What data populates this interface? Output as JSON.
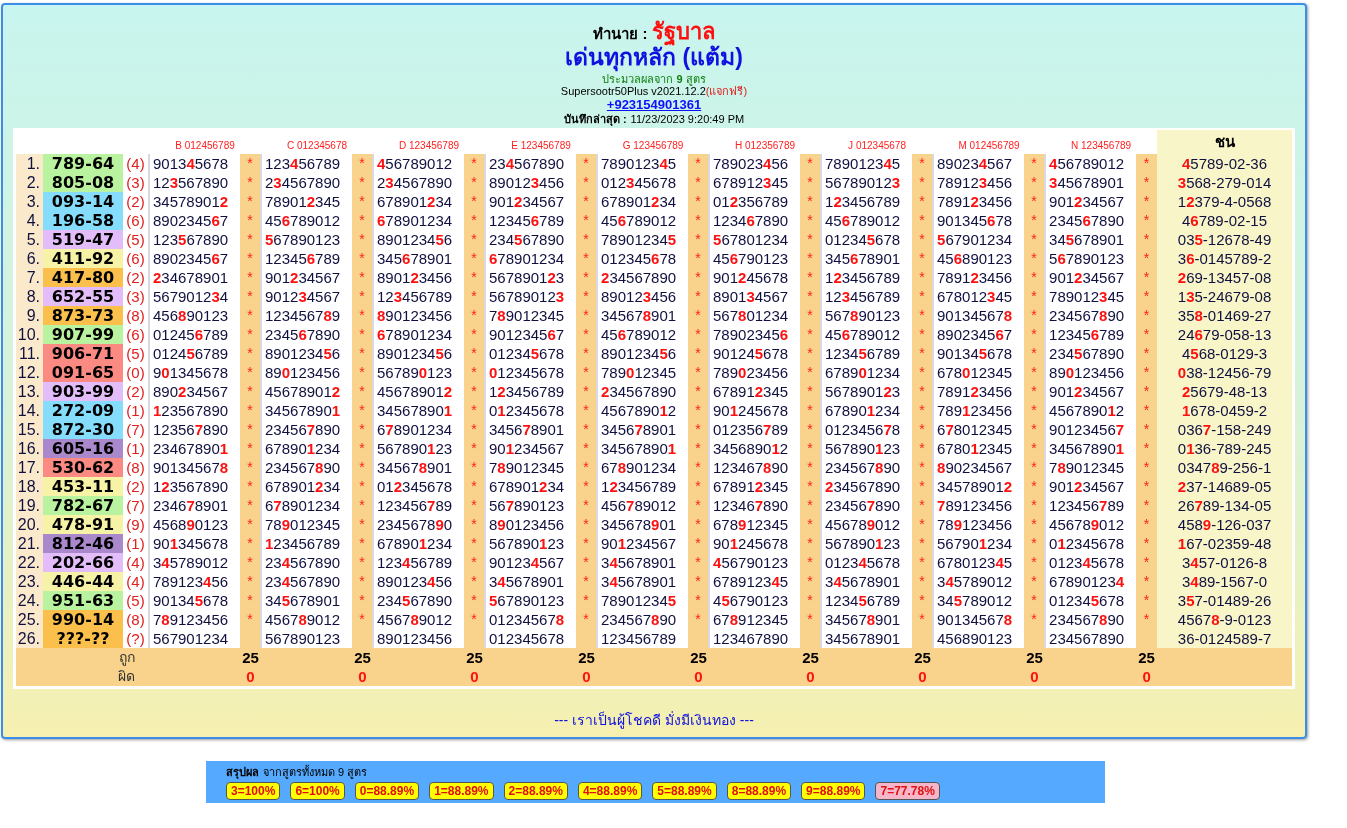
{
  "header": {
    "prefix": "ทำนาย :",
    "title": "รัฐบาล",
    "subtitle": "เด่นทุกหลัก (แต้ม)",
    "formula_note": "ประมวลผลจาก **9** สูตร",
    "version": "Supersootr50Plus v2021.12.2",
    "version_note": "(แจกฟรี)",
    "phone": "+923154901361",
    "saved_label": "บันทึกล่าสุด :",
    "saved_time": "11/23/2023 9:20:49 PM"
  },
  "table": {
    "columns": [
      "B 012456789",
      "C 012345678",
      "D 123456789",
      "E 123456789",
      "G 123456789",
      "H 012356789",
      "J 012345678",
      "M 012456789",
      "N 123456789"
    ],
    "last_column": "ชน",
    "rows": [
      {
        "index": "1.",
        "result": "789-64",
        "color": "#b9f3a0",
        "digit": "(4)",
        "cells": [
          [
            "9013**4**5678",
            "*"
          ],
          [
            "123**4**56789",
            "*"
          ],
          [
            "**4**56789012",
            "*"
          ],
          [
            "23**4**567890",
            "*"
          ],
          [
            "7890123**4**5",
            "*"
          ],
          [
            "789023**4**56",
            "*"
          ],
          [
            "7890123**4**5",
            "*"
          ],
          [
            "89023**4**567",
            "*"
          ],
          [
            "**4**56789012",
            "*"
          ]
        ],
        "chon": "**4**5789-02-36"
      },
      {
        "index": "2.",
        "result": "805-08",
        "color": "#b9f3a0",
        "digit": "(3)",
        "cells": [
          [
            "12**3**567890",
            "*"
          ],
          [
            "2**3**4567890",
            "*"
          ],
          [
            "2**3**4567890",
            "*"
          ],
          [
            "89012**3**456",
            "*"
          ],
          [
            "012**3**45678",
            "*"
          ],
          [
            "678912**3**45",
            "*"
          ],
          [
            "56789012**3**",
            "*"
          ],
          [
            "78912**3**456",
            "*"
          ],
          [
            "**3**45678901",
            "*"
          ]
        ],
        "chon": "**3**568-279-014"
      },
      {
        "index": "3.",
        "result": "093-14",
        "color": "#86dcfb",
        "digit": "(2)",
        "cells": [
          [
            "34578901**2**",
            "*"
          ],
          [
            "78901**2**345",
            "*"
          ],
          [
            "678901**2**34",
            "*"
          ],
          [
            "901**2**34567",
            "*"
          ],
          [
            "678901**2**34",
            "*"
          ],
          [
            "01**2**356789",
            "*"
          ],
          [
            "1**2**3456789",
            "*"
          ],
          [
            "7891**2**3456",
            "*"
          ],
          [
            "901**2**34567",
            "*"
          ]
        ],
        "chon": "1**2**379-4-0568"
      },
      {
        "index": "4.",
        "result": "196-58",
        "color": "#86dcfb",
        "digit": "(6)",
        "cells": [
          [
            "8902345**6**7",
            "*"
          ],
          [
            "45**6**789012",
            "*"
          ],
          [
            "**6**78901234",
            "*"
          ],
          [
            "12345**6**789",
            "*"
          ],
          [
            "45**6**789012",
            "*"
          ],
          [
            "1234**6**7890",
            "*"
          ],
          [
            "45**6**789012",
            "*"
          ],
          [
            "901345**6**78",
            "*"
          ],
          [
            "2345**6**7890",
            "*"
          ]
        ],
        "chon": "4**6**789-02-15"
      },
      {
        "index": "5.",
        "result": "519-47",
        "color": "#e3bdf9",
        "digit": "(5)",
        "cells": [
          [
            "123**5**67890",
            "*"
          ],
          [
            "**5**67890123",
            "*"
          ],
          [
            "8901234**5**6",
            "*"
          ],
          [
            "234**5**67890",
            "*"
          ],
          [
            "78901234**5**",
            "*"
          ],
          [
            "**5**67801234",
            "*"
          ],
          [
            "01234**5**678",
            "*"
          ],
          [
            "**5**67901234",
            "*"
          ],
          [
            "34**5**678901",
            "*"
          ]
        ],
        "chon": "03**5**-12678-49"
      },
      {
        "index": "6.",
        "result": "411-92",
        "color": "#f7f3a6",
        "digit": "(6)",
        "cells": [
          [
            "8902345**6**7",
            "*"
          ],
          [
            "12345**6**789",
            "*"
          ],
          [
            "345**6**78901",
            "*"
          ],
          [
            "**6**78901234",
            "*"
          ],
          [
            "012345**6**78",
            "*"
          ],
          [
            "45**6**790123",
            "*"
          ],
          [
            "345**6**78901",
            "*"
          ],
          [
            "45**6**890123",
            "*"
          ],
          [
            "5**6**7890123",
            "*"
          ]
        ],
        "chon": "3**6**-0145789-2"
      },
      {
        "index": "7.",
        "result": "417-80",
        "color": "#fbc04c",
        "digit": "(2)",
        "cells": [
          [
            "**2**34678901",
            "*"
          ],
          [
            "901**2**34567",
            "*"
          ],
          [
            "8901**2**3456",
            "*"
          ],
          [
            "5678901**2**3",
            "*"
          ],
          [
            "**2**34567890",
            "*"
          ],
          [
            "901**2**45678",
            "*"
          ],
          [
            "1**2**3456789",
            "*"
          ],
          [
            "7891**2**3456",
            "*"
          ],
          [
            "901**2**34567",
            "*"
          ]
        ],
        "chon": "**2**69-13457-08"
      },
      {
        "index": "8.",
        "result": "652-55",
        "color": "#e3bdf9",
        "digit": "(3)",
        "cells": [
          [
            "5679012**3**4",
            "*"
          ],
          [
            "9012**3**4567",
            "*"
          ],
          [
            "12**3**456789",
            "*"
          ],
          [
            "56789012**3**",
            "*"
          ],
          [
            "89012**3**456",
            "*"
          ],
          [
            "8901**3**4567",
            "*"
          ],
          [
            "12**3**456789",
            "*"
          ],
          [
            "678012**3**45",
            "*"
          ],
          [
            "789012**3**45",
            "*"
          ]
        ],
        "chon": "1**3**5-24679-08"
      },
      {
        "index": "9.",
        "result": "873-73",
        "color": "#fbc04c",
        "digit": "(8)",
        "cells": [
          [
            "456**8**90123",
            "*"
          ],
          [
            "1234567**8**9",
            "*"
          ],
          [
            "**8**90123456",
            "*"
          ],
          [
            "7**8**9012345",
            "*"
          ],
          [
            "34567**8**901",
            "*"
          ],
          [
            "567**8**01234",
            "*"
          ],
          [
            "567**8**90123",
            "*"
          ],
          [
            "90134567**8**",
            "*"
          ],
          [
            "234567**8**90",
            "*"
          ]
        ],
        "chon": "35**8**-01469-27"
      },
      {
        "index": "10.",
        "result": "907-99",
        "color": "#b9f3a0",
        "digit": "(6)",
        "cells": [
          [
            "01245**6**789",
            "*"
          ],
          [
            "2345**6**7890",
            "*"
          ],
          [
            "**6**78901234",
            "*"
          ],
          [
            "9012345**6**7",
            "*"
          ],
          [
            "45**6**789012",
            "*"
          ],
          [
            "78902345**6**",
            "*"
          ],
          [
            "45**6**789012",
            "*"
          ],
          [
            "8902345**6**7",
            "*"
          ],
          [
            "12345**6**789",
            "*"
          ]
        ],
        "chon": "24**6**79-058-13"
      },
      {
        "index": "11.",
        "result": "906-71",
        "color": "#fb8a83",
        "digit": "(5)",
        "cells": [
          [
            "0124**5**6789",
            "*"
          ],
          [
            "8901234**5**6",
            "*"
          ],
          [
            "8901234**5**6",
            "*"
          ],
          [
            "01234**5**678",
            "*"
          ],
          [
            "8901234**5**6",
            "*"
          ],
          [
            "90124**5**678",
            "*"
          ],
          [
            "1234**5**6789",
            "*"
          ],
          [
            "90134**5**678",
            "*"
          ],
          [
            "234**5**67890",
            "*"
          ]
        ],
        "chon": "4**5**68-0129-3"
      },
      {
        "index": "12.",
        "result": "091-65",
        "color": "#fb8a83",
        "digit": "(0)",
        "cells": [
          [
            "9**0**1345678",
            "*"
          ],
          [
            "89**0**123456",
            "*"
          ],
          [
            "56789**0**123",
            "*"
          ],
          [
            "**0**12345678",
            "*"
          ],
          [
            "789**0**12345",
            "*"
          ],
          [
            "789**0**23456",
            "*"
          ],
          [
            "6789**0**1234",
            "*"
          ],
          [
            "678**0**12345",
            "*"
          ],
          [
            "89**0**123456",
            "*"
          ]
        ],
        "chon": "**0**38-12456-79"
      },
      {
        "index": "13.",
        "result": "903-99",
        "color": "#e3bdf9",
        "digit": "(2)",
        "cells": [
          [
            "890**2**34567",
            "*"
          ],
          [
            "45678901**2**",
            "*"
          ],
          [
            "45678901**2**",
            "*"
          ],
          [
            "1**2**3456789",
            "*"
          ],
          [
            "**2**34567890",
            "*"
          ],
          [
            "67891**2**345",
            "*"
          ],
          [
            "5678901**2**3",
            "*"
          ],
          [
            "7891**2**3456",
            "*"
          ],
          [
            "901**2**34567",
            "*"
          ]
        ],
        "chon": "**2**5679-48-13"
      },
      {
        "index": "14.",
        "result": "272-09",
        "color": "#86dcfb",
        "digit": "(1)",
        "cells": [
          [
            "**1**23567890",
            "*"
          ],
          [
            "34567890**1**",
            "*"
          ],
          [
            "34567890**1**",
            "*"
          ],
          [
            "0**1**2345678",
            "*"
          ],
          [
            "4567890**1**2",
            "*"
          ],
          [
            "90**1**245678",
            "*"
          ],
          [
            "67890**1**234",
            "*"
          ],
          [
            "789**1**23456",
            "*"
          ],
          [
            "4567890**1**2",
            "*"
          ]
        ],
        "chon": "**1**678-0459-2"
      },
      {
        "index": "15.",
        "result": "872-30",
        "color": "#86dcfb",
        "digit": "(7)",
        "cells": [
          [
            "12356**7**890",
            "*"
          ],
          [
            "23456**7**890",
            "*"
          ],
          [
            "6**7**8901234",
            "*"
          ],
          [
            "3456**7**8901",
            "*"
          ],
          [
            "3456**7**8901",
            "*"
          ],
          [
            "012356**7**89",
            "*"
          ],
          [
            "0123456**7**8",
            "*"
          ],
          [
            "6**7**8012345",
            "*"
          ],
          [
            "90123456**7**",
            "*"
          ]
        ],
        "chon": "036**7**-158-249"
      },
      {
        "index": "16.",
        "result": "605-16",
        "color": "#a988cc",
        "digit": "(1)",
        "cells": [
          [
            "23467890**1**",
            "*"
          ],
          [
            "67890**1**234",
            "*"
          ],
          [
            "567890**1**23",
            "*"
          ],
          [
            "90**1**234567",
            "*"
          ],
          [
            "34567890**1**",
            "*"
          ],
          [
            "3456890**1**2",
            "*"
          ],
          [
            "567890**1**23",
            "*"
          ],
          [
            "6780**1**2345",
            "*"
          ],
          [
            "34567890**1**",
            "*"
          ]
        ],
        "chon": "0**1**36-789-245"
      },
      {
        "index": "17.",
        "result": "530-62",
        "color": "#fb8a83",
        "digit": "(8)",
        "cells": [
          [
            "90134567**8**",
            "*"
          ],
          [
            "234567**8**90",
            "*"
          ],
          [
            "34567**8**901",
            "*"
          ],
          [
            "7**8**9012345",
            "*"
          ],
          [
            "67**8**901234",
            "*"
          ],
          [
            "123467**8**90",
            "*"
          ],
          [
            "234567**8**90",
            "*"
          ],
          [
            "**8**90234567",
            "*"
          ],
          [
            "7**8**9012345",
            "*"
          ]
        ],
        "chon": "0347**8**9-256-1"
      },
      {
        "index": "18.",
        "result": "453-11",
        "color": "#f7f3a6",
        "digit": "(2)",
        "cells": [
          [
            "1**2**3567890",
            "*"
          ],
          [
            "678901**2**34",
            "*"
          ],
          [
            "01**2**345678",
            "*"
          ],
          [
            "678901**2**34",
            "*"
          ],
          [
            "1**2**3456789",
            "*"
          ],
          [
            "67891**2**345",
            "*"
          ],
          [
            "**2**34567890",
            "*"
          ],
          [
            "34578901**2**",
            "*"
          ],
          [
            "901**2**34567",
            "*"
          ]
        ],
        "chon": "**2**37-14689-05"
      },
      {
        "index": "19.",
        "result": "782-67",
        "color": "#b9f3a0",
        "digit": "(7)",
        "cells": [
          [
            "2346**7**8901",
            "*"
          ],
          [
            "6**7**8901234",
            "*"
          ],
          [
            "123456**7**89",
            "*"
          ],
          [
            "56**7**890123",
            "*"
          ],
          [
            "456**7**89012",
            "*"
          ],
          [
            "12346**7**890",
            "*"
          ],
          [
            "23456**7**890",
            "*"
          ],
          [
            "**7**89123456",
            "*"
          ],
          [
            "123456**7**89",
            "*"
          ]
        ],
        "chon": "26**7**89-134-05"
      },
      {
        "index": "20.",
        "result": "478-91",
        "color": "#f7f3a6",
        "digit": "(9)",
        "cells": [
          [
            "4568**9**0123",
            "*"
          ],
          [
            "78**9**012345",
            "*"
          ],
          [
            "2345678**9**0",
            "*"
          ],
          [
            "8**9**0123456",
            "*"
          ],
          [
            "345678**9**01",
            "*"
          ],
          [
            "678**9**12345",
            "*"
          ],
          [
            "45678**9**012",
            "*"
          ],
          [
            "78**9**123456",
            "*"
          ],
          [
            "45678**9**012",
            "*"
          ]
        ],
        "chon": "458**9**-126-037"
      },
      {
        "index": "21.",
        "result": "812-46",
        "color": "#a988cc",
        "digit": "(1)",
        "cells": [
          [
            "90**1**345678",
            "*"
          ],
          [
            "**1**23456789",
            "*"
          ],
          [
            "67890**1**234",
            "*"
          ],
          [
            "567890**1**23",
            "*"
          ],
          [
            "90**1**234567",
            "*"
          ],
          [
            "90**1**245678",
            "*"
          ],
          [
            "567890**1**23",
            "*"
          ],
          [
            "56790**1**234",
            "*"
          ],
          [
            "0**1**2345678",
            "*"
          ]
        ],
        "chon": "**1**67-02359-48"
      },
      {
        "index": "22.",
        "result": "202-66",
        "color": "#e3bdf9",
        "digit": "(4)",
        "cells": [
          [
            "3**4**5789012",
            "*"
          ],
          [
            "23**4**567890",
            "*"
          ],
          [
            "123**4**56789",
            "*"
          ],
          [
            "90123**4**567",
            "*"
          ],
          [
            "3**4**5678901",
            "*"
          ],
          [
            "**4**56790123",
            "*"
          ],
          [
            "0123**4**5678",
            "*"
          ],
          [
            "6780123**4**5",
            "*"
          ],
          [
            "0123**4**5678",
            "*"
          ]
        ],
        "chon": "3**4**57-0126-8"
      },
      {
        "index": "23.",
        "result": "446-44",
        "color": "#f7f3a6",
        "digit": "(4)",
        "cells": [
          [
            "789123**4**56",
            "*"
          ],
          [
            "23**4**567890",
            "*"
          ],
          [
            "890123**4**56",
            "*"
          ],
          [
            "3**4**5678901",
            "*"
          ],
          [
            "3**4**5678901",
            "*"
          ],
          [
            "6789123**4**5",
            "*"
          ],
          [
            "3**4**5678901",
            "*"
          ],
          [
            "3**4**5789012",
            "*"
          ],
          [
            "67890123**4**",
            "*"
          ]
        ],
        "chon": "3**4**89-1567-0"
      },
      {
        "index": "24.",
        "result": "951-63",
        "color": "#b9f3a0",
        "digit": "(5)",
        "cells": [
          [
            "90134**5**678",
            "*"
          ],
          [
            "34**5**678901",
            "*"
          ],
          [
            "234**5**67890",
            "*"
          ],
          [
            "**5**67890123",
            "*"
          ],
          [
            "78901234**5**",
            "*"
          ],
          [
            "4**5**6790123",
            "*"
          ],
          [
            "1234**5**6789",
            "*"
          ],
          [
            "34**5**789012",
            "*"
          ],
          [
            "01234**5**678",
            "*"
          ]
        ],
        "chon": "3**5**7-01489-26"
      },
      {
        "index": "25.",
        "result": "990-14",
        "color": "#fbc04c",
        "digit": "(8)",
        "cells": [
          [
            "7**8**9123456",
            "*"
          ],
          [
            "4567**8**9012",
            "*"
          ],
          [
            "4567**8**9012",
            "*"
          ],
          [
            "01234567**8**",
            "*"
          ],
          [
            "234567**8**90",
            "*"
          ],
          [
            "67**8**912345",
            "*"
          ],
          [
            "34567**8**901",
            "*"
          ],
          [
            "90134567**8**",
            "*"
          ],
          [
            "234567**8**90",
            "*"
          ]
        ],
        "chon": "4567**8**-9-0123"
      },
      {
        "index": "26.",
        "result": "???-??",
        "color": "#fbc04c",
        "digit": "(?)",
        "cells": [
          [
            "567901234"
          ],
          [
            "567890123"
          ],
          [
            "890123456"
          ],
          [
            "012345678"
          ],
          [
            "123456789"
          ],
          [
            "123467890"
          ],
          [
            "345678901"
          ],
          [
            "456890123"
          ],
          [
            "234567890"
          ]
        ],
        "chon": "36-0124589-7"
      }
    ],
    "hit_label": "ถูก",
    "hits": [
      "25",
      "25",
      "25",
      "25",
      "25",
      "25",
      "25",
      "25",
      "25"
    ],
    "miss_label": "ผิด",
    "misses": [
      "0",
      "0",
      "0",
      "0",
      "0",
      "0",
      "0",
      "0",
      "0"
    ]
  },
  "footer_text": "--- เราเป็นผู้โชคดี มั่งมีเงินทอง ---",
  "summary": {
    "title": "สรุปผล",
    "note": "จากสูตรทั้งหมด 9 สูตร",
    "badges": [
      {
        "label": "3=100%",
        "color": "#ffff00"
      },
      {
        "label": "6=100%",
        "color": "#ffff00"
      },
      {
        "label": "0=88.89%",
        "color": "#ffff00"
      },
      {
        "label": "1=88.89%",
        "color": "#ffff00"
      },
      {
        "label": "2=88.89%",
        "color": "#ffff00"
      },
      {
        "label": "4=88.89%",
        "color": "#ffff00"
      },
      {
        "label": "5=88.89%",
        "color": "#ffff00"
      },
      {
        "label": "8=88.89%",
        "color": "#ffff00"
      },
      {
        "label": "9=88.89%",
        "color": "#ffff00"
      },
      {
        "label": "7=77.78%",
        "color": "#f4b6c8"
      }
    ]
  }
}
